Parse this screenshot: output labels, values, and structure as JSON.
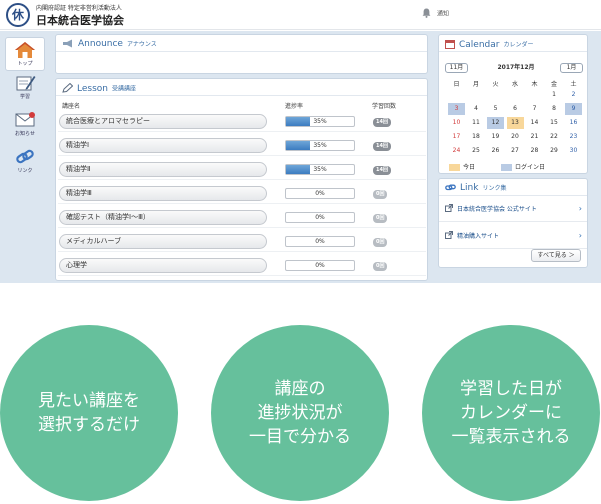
{
  "header": {
    "logo_char": "休",
    "org_subtitle": "内閣府認証 特定非営利活動法人",
    "org_name": "日本統合医学協会",
    "notice_label": "通知"
  },
  "sidebar": {
    "items": [
      {
        "label": "トップ",
        "icon": "home-icon"
      },
      {
        "label": "学習",
        "icon": "pencil-book-icon"
      },
      {
        "label": "お知らせ",
        "icon": "mail-icon"
      },
      {
        "label": "リンク",
        "icon": "chain-link-icon"
      }
    ]
  },
  "announce": {
    "title": "Announce",
    "subtitle": "アナウンス"
  },
  "lesson": {
    "title": "Lesson",
    "subtitle": "受講講座",
    "columns": {
      "course": "講座名",
      "progress": "進捗率",
      "count": "学習回数"
    },
    "rows": [
      {
        "name": "統合医療とアロマセラピー",
        "progress_text": "35%",
        "progress": 0.35,
        "count": "14回"
      },
      {
        "name": "精油学Ⅰ",
        "progress_text": "35%",
        "progress": 0.35,
        "count": "14回"
      },
      {
        "name": "精油学Ⅱ",
        "progress_text": "35%",
        "progress": 0.35,
        "count": "14回"
      },
      {
        "name": "精油学Ⅲ",
        "progress_text": "0%",
        "progress": 0,
        "count": "0回"
      },
      {
        "name": "確認テスト（精油学Ⅰ～Ⅲ）",
        "progress_text": "0%",
        "progress": 0,
        "count": "0回"
      },
      {
        "name": "メディカルハーブ",
        "progress_text": "0%",
        "progress": 0,
        "count": "0回"
      },
      {
        "name": "心理学",
        "progress_text": "0%",
        "progress": 0,
        "count": "0回"
      }
    ],
    "badge_active_color": "#8a8f96",
    "badge_zero_color": "#b7bcc2"
  },
  "calendar": {
    "title": "Calendar",
    "subtitle": "カレンダー",
    "prev_label": "11月",
    "next_label": "1月",
    "month_label": "2017年12月",
    "weekdays": [
      "日",
      "月",
      "火",
      "水",
      "木",
      "金",
      "土"
    ],
    "weeks": [
      [
        "",
        "",
        "",
        "",
        "",
        "1",
        "2"
      ],
      [
        "3",
        "4",
        "5",
        "6",
        "7",
        "8",
        "9"
      ],
      [
        "10",
        "11",
        "12",
        "13",
        "14",
        "15",
        "16"
      ],
      [
        "17",
        "18",
        "19",
        "20",
        "21",
        "22",
        "23"
      ],
      [
        "24",
        "25",
        "26",
        "27",
        "28",
        "29",
        "30"
      ]
    ],
    "today": "13",
    "login_days": [
      "3",
      "9",
      "12"
    ],
    "legend_today": "今日",
    "legend_login": "ログイン日",
    "today_color": "#f8d79a",
    "login_color": "#b9cbe4",
    "sunday_color": "#d23b3b",
    "saturday_color": "#2f5fa8"
  },
  "links": {
    "title": "Link",
    "subtitle": "リンク集",
    "items": [
      {
        "label": "日本統合医学協会 公式サイト"
      },
      {
        "label": "精油購入サイト"
      }
    ],
    "more_label": "すべて見る ＞"
  },
  "features": [
    {
      "text": "見たい講座を\n選択するだけ"
    },
    {
      "text": "講座の\n進捗状況が\n一目で分かる"
    },
    {
      "text": "学習した日が\nカレンダーに\n一覧表示される"
    }
  ]
}
